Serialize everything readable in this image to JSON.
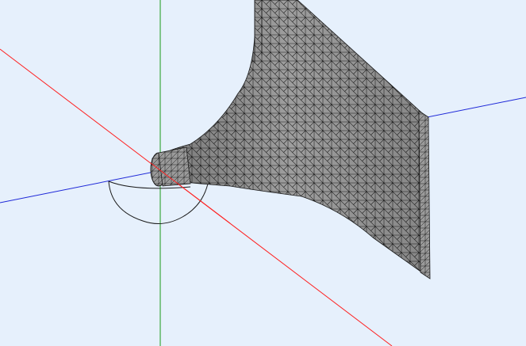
{
  "viewport": {
    "background": "#e6f0fc",
    "axes": {
      "x_axis_color": "#ff2020",
      "y_axis_color": "#1a9a1a",
      "z_axis_color": "#1e28d8"
    },
    "model": {
      "mesh_face_color": "#9e9e9e",
      "mesh_shade_color": "#5a5a5a",
      "mesh_edge_color": "#1a1a1a"
    },
    "rotation_indicator_color": "#1a1a1a"
  }
}
